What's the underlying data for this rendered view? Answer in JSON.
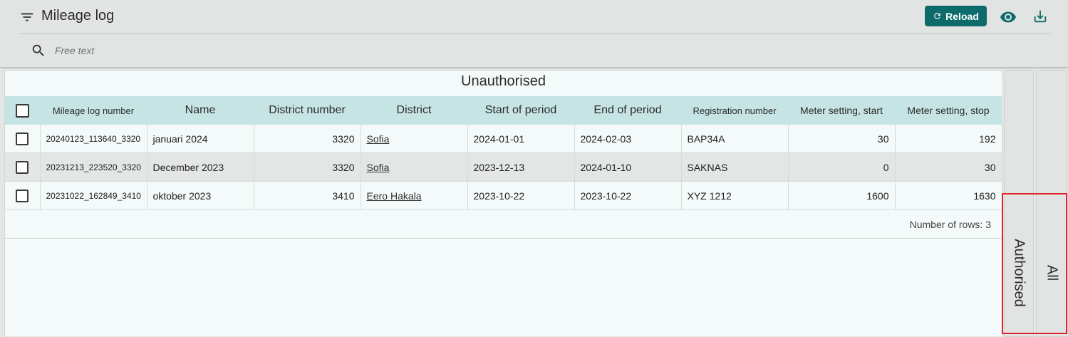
{
  "header": {
    "title": "Mileage log",
    "reload_label": "Reload",
    "search_placeholder": "Free text"
  },
  "panel": {
    "title": "Unauthorised",
    "columns": [
      "Mileage log number",
      "Name",
      "District number",
      "District",
      "Start of period",
      "End of period",
      "Registration number",
      "Meter setting, start",
      "Meter setting, stop"
    ],
    "rows": [
      [
        "20240123_113640_3320",
        "januari 2024",
        "3320",
        "Sofia",
        "2024-01-01",
        "2024-02-03",
        "BAP34A",
        "30",
        "192"
      ],
      [
        "20231213_223520_3320",
        "December 2023",
        "3320",
        "Sofia",
        "2023-12-13",
        "2024-01-10",
        "SAKNAS",
        "0",
        "30"
      ],
      [
        "20231022_162849_3410",
        "oktober 2023",
        "3410",
        "Eero Hakala",
        "2023-10-22",
        "2023-10-22",
        "XYZ 1212",
        "1600",
        "1630"
      ]
    ],
    "row_count": "Number of rows: 3"
  },
  "side_tabs": {
    "authorised": "Authorised",
    "all": "All"
  },
  "colors": {
    "accent": "#0d6b6b",
    "header_row": "#c6e4e3",
    "highlight": "#e0222a"
  },
  "icons": [
    "filter-icon",
    "refresh-icon",
    "eye-icon",
    "download-icon",
    "search-icon"
  ]
}
